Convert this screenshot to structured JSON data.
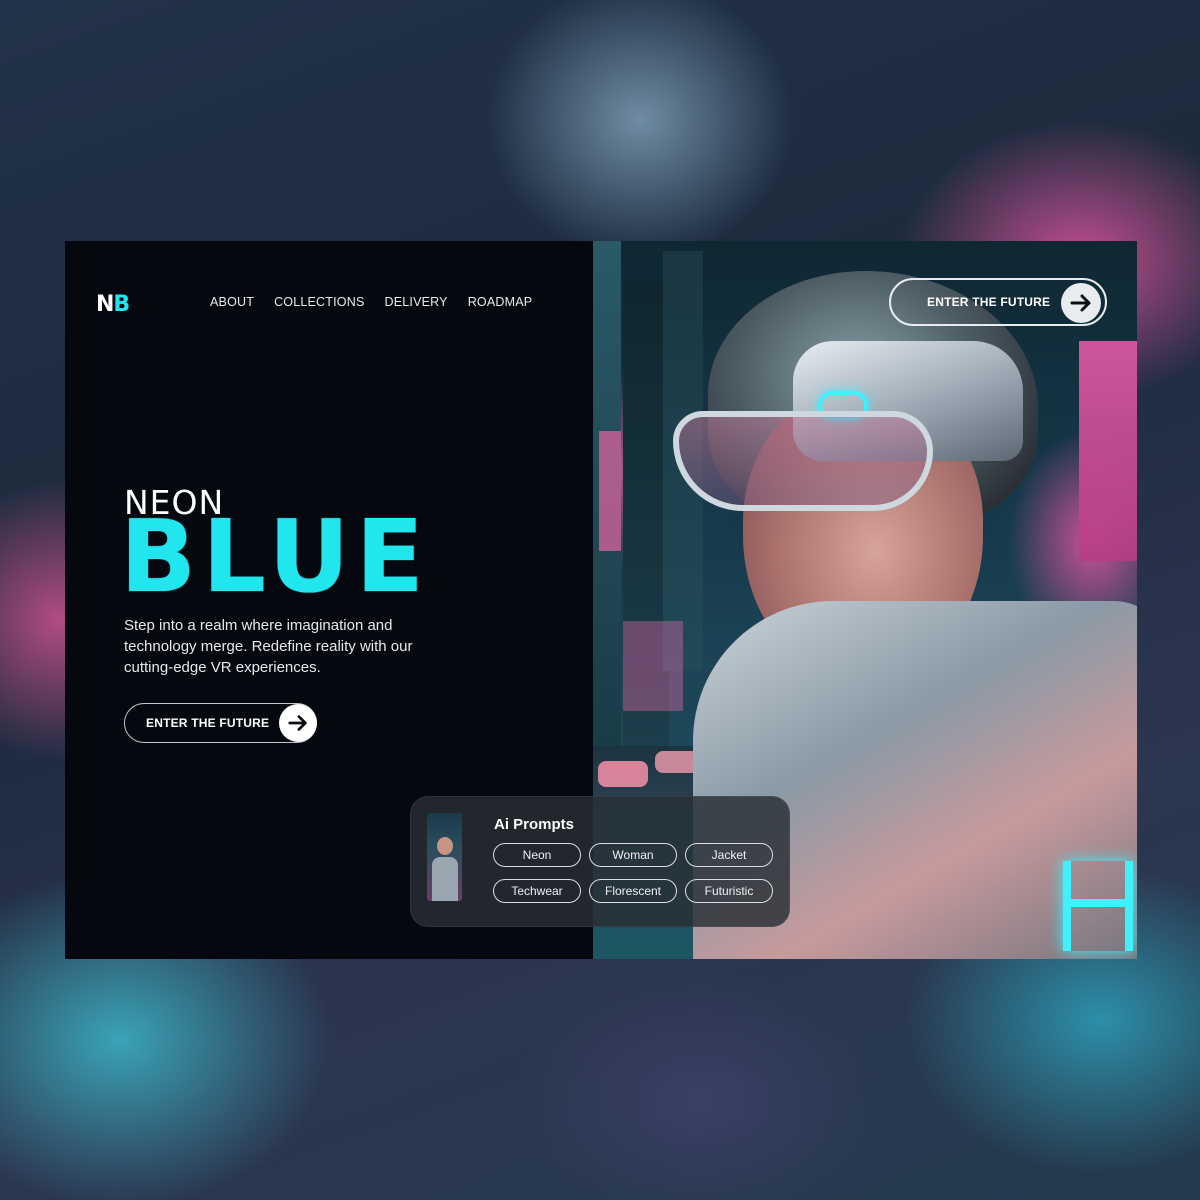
{
  "brand": {
    "logo_first": "N",
    "logo_second": "B"
  },
  "nav": {
    "items": [
      {
        "label": "ABOUT"
      },
      {
        "label": "COLLECTIONS"
      },
      {
        "label": "DELIVERY"
      },
      {
        "label": "ROADMAP"
      }
    ]
  },
  "header_cta": {
    "label": "ENTER THE FUTURE",
    "icon": "arrow-right-icon"
  },
  "hero": {
    "title_small": "NEON",
    "title_big": "BLUE",
    "description": "Step into a realm where imagination and technology merge. Redefine reality with our cutting-edge VR experiences.",
    "cta_label": "ENTER THE FUTURE"
  },
  "prompts": {
    "title": "Ai Prompts",
    "tags": [
      "Neon",
      "Woman",
      "Jacket",
      "Techwear",
      "Florescent",
      "Futuristic"
    ]
  },
  "colors": {
    "accent": "#22e6ee",
    "panel": "#05080e",
    "neon_pink": "#e856a6"
  }
}
